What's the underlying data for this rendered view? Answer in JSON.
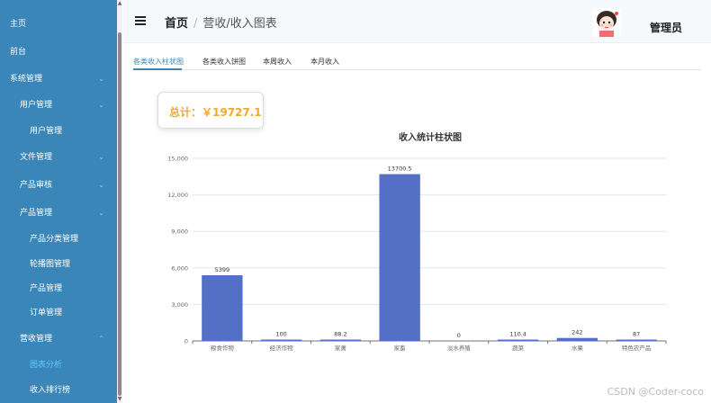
{
  "sidebar": {
    "items": [
      {
        "label": "主页",
        "chevron": false,
        "active": false
      },
      {
        "label": "前台",
        "chevron": false,
        "active": false
      },
      {
        "label": "系统管理",
        "chevron": true,
        "active": false
      },
      {
        "label": "用户管理",
        "chevron": true,
        "active": false
      },
      {
        "label": "用户管理",
        "chevron": false,
        "active": false
      },
      {
        "label": "文件管理",
        "chevron": true,
        "active": false
      },
      {
        "label": "产品审核",
        "chevron": true,
        "active": false
      },
      {
        "label": "产品管理",
        "chevron": true,
        "active": false
      },
      {
        "label": "产品分类管理",
        "chevron": false,
        "active": false
      },
      {
        "label": "轮播图管理",
        "chevron": false,
        "active": false
      },
      {
        "label": "产品管理",
        "chevron": false,
        "active": false
      },
      {
        "label": "订单管理",
        "chevron": false,
        "active": false
      },
      {
        "label": "营收管理",
        "chevron": true,
        "active": false
      },
      {
        "label": "图表分析",
        "chevron": false,
        "active": true
      },
      {
        "label": "收入排行榜",
        "chevron": false,
        "active": false
      }
    ],
    "colors": {
      "bg": "#3a86b8",
      "active": "#5ec7ff"
    }
  },
  "header": {
    "breadcrumb_home": "首页",
    "breadcrumb_sep": "/",
    "breadcrumb_current": "营收/收入图表",
    "user_name": "管理员"
  },
  "tabs": [
    {
      "label": "各类收入柱状图",
      "active": true
    },
    {
      "label": "各类收入饼图",
      "active": false
    },
    {
      "label": "本周收入",
      "active": false
    },
    {
      "label": "本月收入",
      "active": false
    }
  ],
  "total": {
    "text": "总计：￥19727.1",
    "color": "#f0a830"
  },
  "chart_data": {
    "type": "bar",
    "title": "收入统计柱状图",
    "categories": [
      "粮食作物",
      "经济作物",
      "家禽",
      "家畜",
      "淡水养殖",
      "蔬菜",
      "水果",
      "特色农产品"
    ],
    "values": [
      5399,
      100,
      88.2,
      13700.5,
      0,
      110.4,
      242,
      87
    ],
    "value_labels": [
      "5399",
      "100",
      "88.2",
      "13700.5",
      "0",
      "110.4",
      "242",
      "87"
    ],
    "yticks": [
      "0",
      "3,000",
      "6,000",
      "9,000",
      "12,000",
      "15,000"
    ],
    "ylim": [
      0,
      15000
    ],
    "grid": true,
    "bar_color": "#5470c6"
  },
  "watermark": "CSDN @Coder-coco"
}
